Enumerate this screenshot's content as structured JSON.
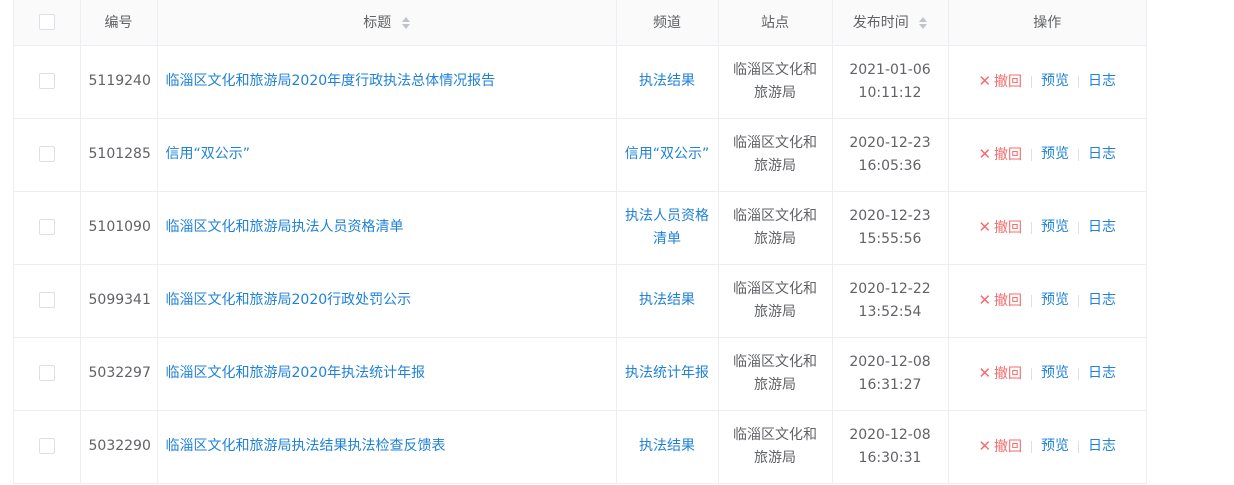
{
  "table": {
    "headers": {
      "id": "编号",
      "title": "标题",
      "channel": "频道",
      "site": "站点",
      "publish_time": "发布时间",
      "actions": "操作"
    },
    "action_labels": {
      "revoke": "撤回",
      "preview": "预览",
      "log": "日志"
    },
    "rows": [
      {
        "id": "5119240",
        "title": "临淄区文化和旅游局2020年度行政执法总体情况报告",
        "channel": "执法结果",
        "site": "临淄区文化和旅游局",
        "date": "2021-01-06",
        "time": "10:11:12"
      },
      {
        "id": "5101285",
        "title": "信用“双公示”",
        "channel": "信用“双公示”",
        "site": "临淄区文化和旅游局",
        "date": "2020-12-23",
        "time": "16:05:36"
      },
      {
        "id": "5101090",
        "title": "临淄区文化和旅游局执法人员资格清单",
        "channel": "执法人员资格清单",
        "site": "临淄区文化和旅游局",
        "date": "2020-12-23",
        "time": "15:55:56"
      },
      {
        "id": "5099341",
        "title": "临淄区文化和旅游局2020行政处罚公示",
        "channel": "执法结果",
        "site": "临淄区文化和旅游局",
        "date": "2020-12-22",
        "time": "13:52:54"
      },
      {
        "id": "5032297",
        "title": "临淄区文化和旅游局2020年执法统计年报",
        "channel": "执法统计年报",
        "site": "临淄区文化和旅游局",
        "date": "2020-12-08",
        "time": "16:31:27"
      },
      {
        "id": "5032290",
        "title": "临淄区文化和旅游局执法结果执法检查反馈表",
        "channel": "执法结果",
        "site": "临淄区文化和旅游局",
        "date": "2020-12-08",
        "time": "16:30:31"
      }
    ]
  },
  "colors": {
    "link": "#1f82d8",
    "danger": "#f56c6c",
    "header_bg": "#fafafa",
    "border": "#ebeef5"
  }
}
